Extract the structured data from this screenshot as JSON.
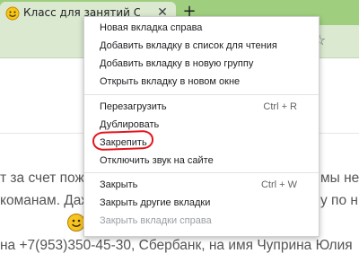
{
  "browser": {
    "tab": {
      "title": "Класс для занятий Сеня | Народ",
      "close_glyph": "✕",
      "favicon": "smiley-favicon-icon"
    },
    "new_tab_glyph": "+",
    "bookmark_glyph": "☆"
  },
  "page": {
    "line1_left": "т за счет пож",
    "line1_right": "мы не б",
    "line2_left": "команам. Даж",
    "line2_right": "у по н",
    "line3": "на +7(953)350-45-30, Сбербанк, на имя Чуприна Юлия"
  },
  "context_menu": {
    "items": [
      {
        "label": "Новая вкладка справа",
        "shortcut": ""
      },
      {
        "label": "Добавить вкладку в список для чтения",
        "shortcut": ""
      },
      {
        "label": "Добавить вкладку в новую группу",
        "shortcut": ""
      },
      {
        "label": "Открыть вкладку в новом окне",
        "shortcut": ""
      },
      {
        "label": "Перезагрузить",
        "shortcut": "Ctrl + R"
      },
      {
        "label": "Дублировать",
        "shortcut": ""
      },
      {
        "label": "Закрепить",
        "shortcut": ""
      },
      {
        "label": "Отключить звук на сайте",
        "shortcut": ""
      },
      {
        "label": "Закрыть",
        "shortcut": "Ctrl + W"
      },
      {
        "label": "Закрыть другие вкладки",
        "shortcut": ""
      },
      {
        "label": "Закрыть вкладки справа",
        "shortcut": ""
      }
    ],
    "highlighted_item": "Закрепить",
    "highlight_color": "#e3141b"
  },
  "colors": {
    "tabstrip": "#9fcf7e",
    "active_tab": "#dbe9d0"
  }
}
